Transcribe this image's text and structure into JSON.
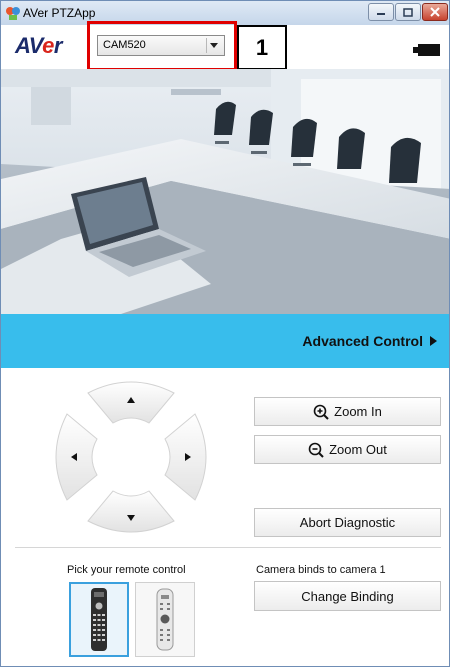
{
  "window": {
    "title": "AVer PTZApp"
  },
  "header": {
    "logo_prefix": "AV",
    "logo_accent": "e",
    "logo_suffix": "r",
    "camera_select": {
      "value": "CAM520"
    },
    "callout_number": "1"
  },
  "advanced": {
    "label": "Advanced Control"
  },
  "controls": {
    "zoom_in": "Zoom In",
    "zoom_out": "Zoom Out",
    "abort": "Abort Diagnostic"
  },
  "remote": {
    "pick_label": "Pick your remote control",
    "bind_label": "Camera binds to camera 1",
    "change_binding": "Change Binding"
  },
  "colors": {
    "accent_bar": "#38bdec",
    "highlight": "#e00000",
    "logo_blue": "#1b2b6b",
    "logo_red": "#d9251c"
  }
}
